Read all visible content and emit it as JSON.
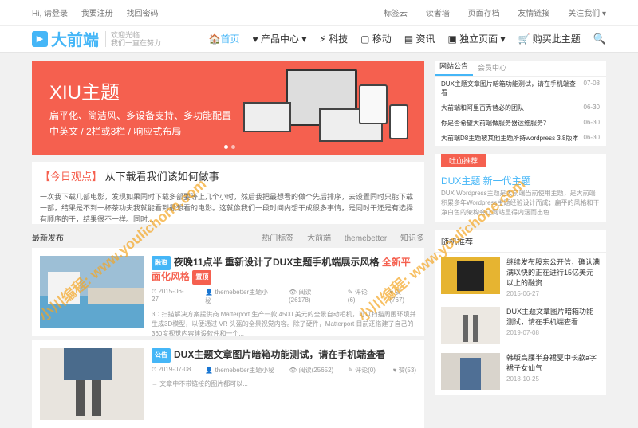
{
  "topbar": {
    "login": "Hi, 请登录",
    "register": "我要注册",
    "forgot": "找回密码",
    "right": [
      "标签云",
      "读者墙",
      "页面存档",
      "友情链接",
      "关注我们 ▾"
    ]
  },
  "header": {
    "logo_icon": "▶",
    "logo": "大前端",
    "sub1": "欢迎光临",
    "sub2": "我们一直在努力",
    "nav": [
      "🏠首页",
      "♥ 产品中心 ▾",
      "⚡ 科技",
      "▢ 移动",
      "▤ 资讯",
      "▣ 独立页面 ▾",
      "🛒 购买此主题"
    ],
    "search_icon": "🔍"
  },
  "banner": {
    "title": "XIU主题",
    "line1": "扁平化、简洁风、多设备支持、多功能配置",
    "line2": "中英文 / 2栏或3栏 / 响应式布局"
  },
  "viewpoint": {
    "tag": "【今日观点】",
    "title": " 从下载看我们该如何做事",
    "text": "一次我下载几部电影，发现如果同时下载多部要等上几个小时，然后我把最想看的做个先后排序，去设置同时只能下载一部，结果是不到一杯茶功夫我就能看到最想看的电影。这就像我们一段时间内想干成很多事情，是同时干还是有选择有顺序的干，结果很不一样。同时..."
  },
  "section": {
    "title": "最新发布",
    "links": [
      "热门标签",
      "大前端",
      "themebetter",
      "知识多"
    ]
  },
  "posts": [
    {
      "badge": "融资",
      "title": "夜晚11点半 重新设计了DUX主题手机端展示风格 ",
      "hi": "全新平面化风格",
      "badge2": "置顶",
      "date": "⏱ 2015-06-27",
      "author": "👤 themebetter主题小秘",
      "views": "👁 阅读(26178)",
      "comments": "✎ 评论(6)",
      "likes": "♥ 赞(767)",
      "excerpt": "3D 扫描解决方案提供商 Matterport 生产一款 4500 美元的全景自动相机，可以扫描周围环境并生成3D模型，以便通过 VR 头盔的全景视觉内容。除了硬件，Matterport 目前还搭建了自己的360度视觉内容建设软件和一个..."
    },
    {
      "badge": "公告",
      "title": "DUX主题文章图片暗箱功能测试，请在手机端查看",
      "date": "⏱ 2019-07-08",
      "author": "👤 themebetter主题小秘",
      "views": "👁 阅读(25652)",
      "comments": "✎ 评论(0)",
      "likes": "♥ 赞(53)",
      "excerpt": "→ 文章中不带链接的图片都可以..."
    }
  ],
  "sidebar": {
    "tabs": [
      "网站公告",
      "会员中心"
    ],
    "announcements": [
      {
        "t": "DUX主题文章图片暗箱功能测试，请在手机端查看",
        "d": "07-08"
      },
      {
        "t": "大前端和阿里百秀替必的团队",
        "d": "06-30"
      },
      {
        "t": "你是否希望大前端做服务器运维服务？",
        "d": "06-30"
      },
      {
        "t": "大前端D8主题被其他主题所持wordpress 3.8版本",
        "d": "06-30"
      }
    ],
    "rec_tag": "吐血推荐",
    "rec_title": "DUX主题 新一代主题",
    "rec_text": "DUX Wordpress主题是大前端当前使用主题，是大前端积累多年Wordpress主题经验设计而成；扁平的风格和干净白色的架构会让网站显得内涵而出色...",
    "random_title": "随机推荐",
    "random": [
      {
        "t": "继续发布股东公开信，确认满满以快的正在进行15亿美元以上的融资",
        "d": "2015-06-27"
      },
      {
        "t": "DUX主题文章图片暗箱功能测试，请在手机端查看",
        "d": "2019-07-08"
      },
      {
        "t": "韩版高腰半身裙夏中长款a字裙子女仙气",
        "d": "2018-10-25"
      }
    ]
  },
  "watermark": "小川编程: www.youlichone.com"
}
